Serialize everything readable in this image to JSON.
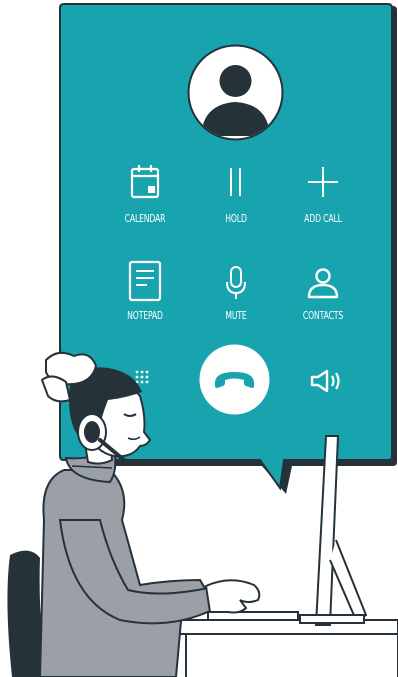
{
  "call_screen": {
    "background_color": "#18a4ae",
    "shadow_color": "#26323a",
    "avatar": {
      "icon": "user-avatar-icon"
    },
    "controls": [
      {
        "id": "calendar",
        "label": "CALENDAR",
        "icon": "calendar-icon"
      },
      {
        "id": "hold",
        "label": "HOLD",
        "icon": "pause-icon"
      },
      {
        "id": "add_call",
        "label": "ADD CALL",
        "icon": "plus-icon"
      },
      {
        "id": "notepad",
        "label": "NOTEPAD",
        "icon": "notepad-icon"
      },
      {
        "id": "mute",
        "label": "MUTE",
        "icon": "microphone-icon"
      },
      {
        "id": "contacts",
        "label": "CONTACTS",
        "icon": "contacts-icon"
      }
    ],
    "keypad": {
      "icon": "keypad-icon"
    },
    "end_call": {
      "icon": "end-call-icon"
    },
    "speaker": {
      "icon": "speaker-icon"
    }
  },
  "illustration": {
    "subject": "woman-with-headset-at-computer"
  }
}
